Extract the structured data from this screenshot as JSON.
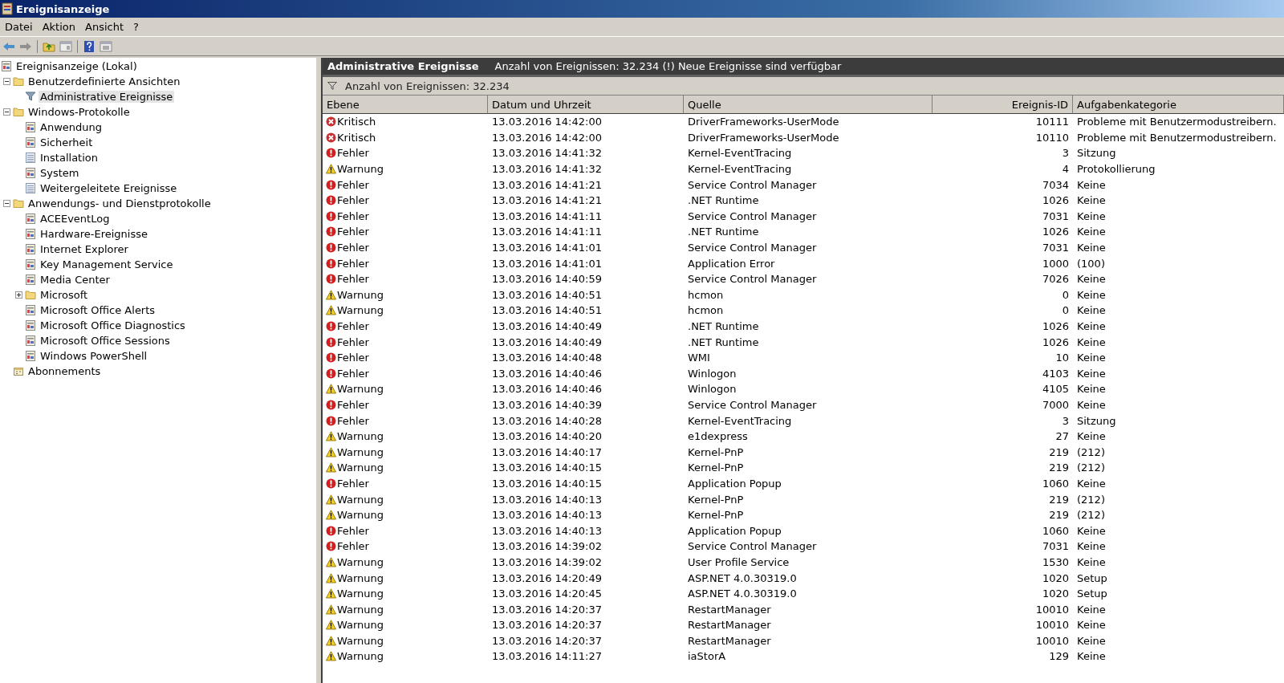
{
  "window": {
    "title": "Ereignisanzeige"
  },
  "menu": [
    {
      "label": "Datei"
    },
    {
      "label": "Aktion"
    },
    {
      "label": "Ansicht"
    },
    {
      "label": "?"
    }
  ],
  "tree": [
    {
      "label": "Ereignisanzeige (Lokal)",
      "kind": "log",
      "selected": false,
      "children": [
        {
          "label": "Benutzerdefinierte Ansichten",
          "kind": "folder",
          "selected": false,
          "expanded": true,
          "children": [
            {
              "label": "Administrative Ereignisse",
              "kind": "filter",
              "selected": true
            }
          ]
        },
        {
          "label": "Windows-Protokolle",
          "kind": "folder",
          "selected": false,
          "expanded": true,
          "children": [
            {
              "label": "Anwendung",
              "kind": "log",
              "selected": false
            },
            {
              "label": "Sicherheit",
              "kind": "log",
              "selected": false
            },
            {
              "label": "Installation",
              "kind": "plainlog",
              "selected": false
            },
            {
              "label": "System",
              "kind": "log",
              "selected": false
            },
            {
              "label": "Weitergeleitete Ereignisse",
              "kind": "plainlog",
              "selected": false
            }
          ]
        },
        {
          "label": "Anwendungs- und Dienstprotokolle",
          "kind": "folder",
          "selected": false,
          "expanded": true,
          "children": [
            {
              "label": "ACEEventLog",
              "kind": "log",
              "selected": false
            },
            {
              "label": "Hardware-Ereignisse",
              "kind": "log",
              "selected": false
            },
            {
              "label": "Internet Explorer",
              "kind": "log",
              "selected": false
            },
            {
              "label": "Key Management Service",
              "kind": "log",
              "selected": false
            },
            {
              "label": "Media Center",
              "kind": "log",
              "selected": false
            },
            {
              "label": "Microsoft",
              "kind": "folder",
              "selected": false,
              "expanded": false
            },
            {
              "label": "Microsoft Office Alerts",
              "kind": "log",
              "selected": false
            },
            {
              "label": "Microsoft Office Diagnostics",
              "kind": "log",
              "selected": false
            },
            {
              "label": "Microsoft Office Sessions",
              "kind": "log",
              "selected": false
            },
            {
              "label": "Windows PowerShell",
              "kind": "log",
              "selected": false
            }
          ]
        },
        {
          "label": "Abonnements",
          "kind": "subscriptions",
          "selected": false
        }
      ]
    }
  ],
  "panel": {
    "title": "Administrative Ereignisse",
    "info": "Anzahl von Ereignissen: 32.234 (!) Neue Ereignisse sind verfügbar"
  },
  "filter_bar": {
    "text": "Anzahl von Ereignissen: 32.234"
  },
  "table": {
    "columns": [
      "Ebene",
      "Datum und Uhrzeit",
      "Quelle",
      "Ereignis-ID",
      "Aufgabenkategorie"
    ],
    "rows": [
      {
        "kind": "critical",
        "level": "Kritisch",
        "date": "13.03.2016 14:42:00",
        "source": "DriverFrameworks-UserMode",
        "id": "10111",
        "category": "Probleme mit Benutzermodustreibern."
      },
      {
        "kind": "critical",
        "level": "Kritisch",
        "date": "13.03.2016 14:42:00",
        "source": "DriverFrameworks-UserMode",
        "id": "10110",
        "category": "Probleme mit Benutzermodustreibern."
      },
      {
        "kind": "error",
        "level": "Fehler",
        "date": "13.03.2016 14:41:32",
        "source": "Kernel-EventTracing",
        "id": "3",
        "category": "Sitzung"
      },
      {
        "kind": "warning",
        "level": "Warnung",
        "date": "13.03.2016 14:41:32",
        "source": "Kernel-EventTracing",
        "id": "4",
        "category": "Protokollierung"
      },
      {
        "kind": "error",
        "level": "Fehler",
        "date": "13.03.2016 14:41:21",
        "source": "Service Control Manager",
        "id": "7034",
        "category": "Keine"
      },
      {
        "kind": "error",
        "level": "Fehler",
        "date": "13.03.2016 14:41:21",
        "source": ".NET Runtime",
        "id": "1026",
        "category": "Keine"
      },
      {
        "kind": "error",
        "level": "Fehler",
        "date": "13.03.2016 14:41:11",
        "source": "Service Control Manager",
        "id": "7031",
        "category": "Keine"
      },
      {
        "kind": "error",
        "level": "Fehler",
        "date": "13.03.2016 14:41:11",
        "source": ".NET Runtime",
        "id": "1026",
        "category": "Keine"
      },
      {
        "kind": "error",
        "level": "Fehler",
        "date": "13.03.2016 14:41:01",
        "source": "Service Control Manager",
        "id": "7031",
        "category": "Keine"
      },
      {
        "kind": "error",
        "level": "Fehler",
        "date": "13.03.2016 14:41:01",
        "source": "Application Error",
        "id": "1000",
        "category": "(100)"
      },
      {
        "kind": "error",
        "level": "Fehler",
        "date": "13.03.2016 14:40:59",
        "source": "Service Control Manager",
        "id": "7026",
        "category": "Keine"
      },
      {
        "kind": "warning",
        "level": "Warnung",
        "date": "13.03.2016 14:40:51",
        "source": "hcmon",
        "id": "0",
        "category": "Keine"
      },
      {
        "kind": "warning",
        "level": "Warnung",
        "date": "13.03.2016 14:40:51",
        "source": "hcmon",
        "id": "0",
        "category": "Keine"
      },
      {
        "kind": "error",
        "level": "Fehler",
        "date": "13.03.2016 14:40:49",
        "source": ".NET Runtime",
        "id": "1026",
        "category": "Keine"
      },
      {
        "kind": "error",
        "level": "Fehler",
        "date": "13.03.2016 14:40:49",
        "source": ".NET Runtime",
        "id": "1026",
        "category": "Keine"
      },
      {
        "kind": "error",
        "level": "Fehler",
        "date": "13.03.2016 14:40:48",
        "source": "WMI",
        "id": "10",
        "category": "Keine"
      },
      {
        "kind": "error",
        "level": "Fehler",
        "date": "13.03.2016 14:40:46",
        "source": "Winlogon",
        "id": "4103",
        "category": "Keine"
      },
      {
        "kind": "warning",
        "level": "Warnung",
        "date": "13.03.2016 14:40:46",
        "source": "Winlogon",
        "id": "4105",
        "category": "Keine"
      },
      {
        "kind": "error",
        "level": "Fehler",
        "date": "13.03.2016 14:40:39",
        "source": "Service Control Manager",
        "id": "7000",
        "category": "Keine"
      },
      {
        "kind": "error",
        "level": "Fehler",
        "date": "13.03.2016 14:40:28",
        "source": "Kernel-EventTracing",
        "id": "3",
        "category": "Sitzung"
      },
      {
        "kind": "warning",
        "level": "Warnung",
        "date": "13.03.2016 14:40:20",
        "source": "e1dexpress",
        "id": "27",
        "category": "Keine"
      },
      {
        "kind": "warning",
        "level": "Warnung",
        "date": "13.03.2016 14:40:17",
        "source": "Kernel-PnP",
        "id": "219",
        "category": "(212)"
      },
      {
        "kind": "warning",
        "level": "Warnung",
        "date": "13.03.2016 14:40:15",
        "source": "Kernel-PnP",
        "id": "219",
        "category": "(212)"
      },
      {
        "kind": "error",
        "level": "Fehler",
        "date": "13.03.2016 14:40:15",
        "source": "Application Popup",
        "id": "1060",
        "category": "Keine"
      },
      {
        "kind": "warning",
        "level": "Warnung",
        "date": "13.03.2016 14:40:13",
        "source": "Kernel-PnP",
        "id": "219",
        "category": "(212)"
      },
      {
        "kind": "warning",
        "level": "Warnung",
        "date": "13.03.2016 14:40:13",
        "source": "Kernel-PnP",
        "id": "219",
        "category": "(212)"
      },
      {
        "kind": "error",
        "level": "Fehler",
        "date": "13.03.2016 14:40:13",
        "source": "Application Popup",
        "id": "1060",
        "category": "Keine"
      },
      {
        "kind": "error",
        "level": "Fehler",
        "date": "13.03.2016 14:39:02",
        "source": "Service Control Manager",
        "id": "7031",
        "category": "Keine"
      },
      {
        "kind": "warning",
        "level": "Warnung",
        "date": "13.03.2016 14:39:02",
        "source": "User Profile Service",
        "id": "1530",
        "category": "Keine"
      },
      {
        "kind": "warning",
        "level": "Warnung",
        "date": "13.03.2016 14:20:49",
        "source": "ASP.NET 4.0.30319.0",
        "id": "1020",
        "category": "Setup"
      },
      {
        "kind": "warning",
        "level": "Warnung",
        "date": "13.03.2016 14:20:45",
        "source": "ASP.NET 4.0.30319.0",
        "id": "1020",
        "category": "Setup"
      },
      {
        "kind": "warning",
        "level": "Warnung",
        "date": "13.03.2016 14:20:37",
        "source": "RestartManager",
        "id": "10010",
        "category": "Keine"
      },
      {
        "kind": "warning",
        "level": "Warnung",
        "date": "13.03.2016 14:20:37",
        "source": "RestartManager",
        "id": "10010",
        "category": "Keine"
      },
      {
        "kind": "warning",
        "level": "Warnung",
        "date": "13.03.2016 14:20:37",
        "source": "RestartManager",
        "id": "10010",
        "category": "Keine"
      },
      {
        "kind": "warning",
        "level": "Warnung",
        "date": "13.03.2016 14:11:27",
        "source": "iaStorA",
        "id": "129",
        "category": "Keine"
      }
    ]
  }
}
